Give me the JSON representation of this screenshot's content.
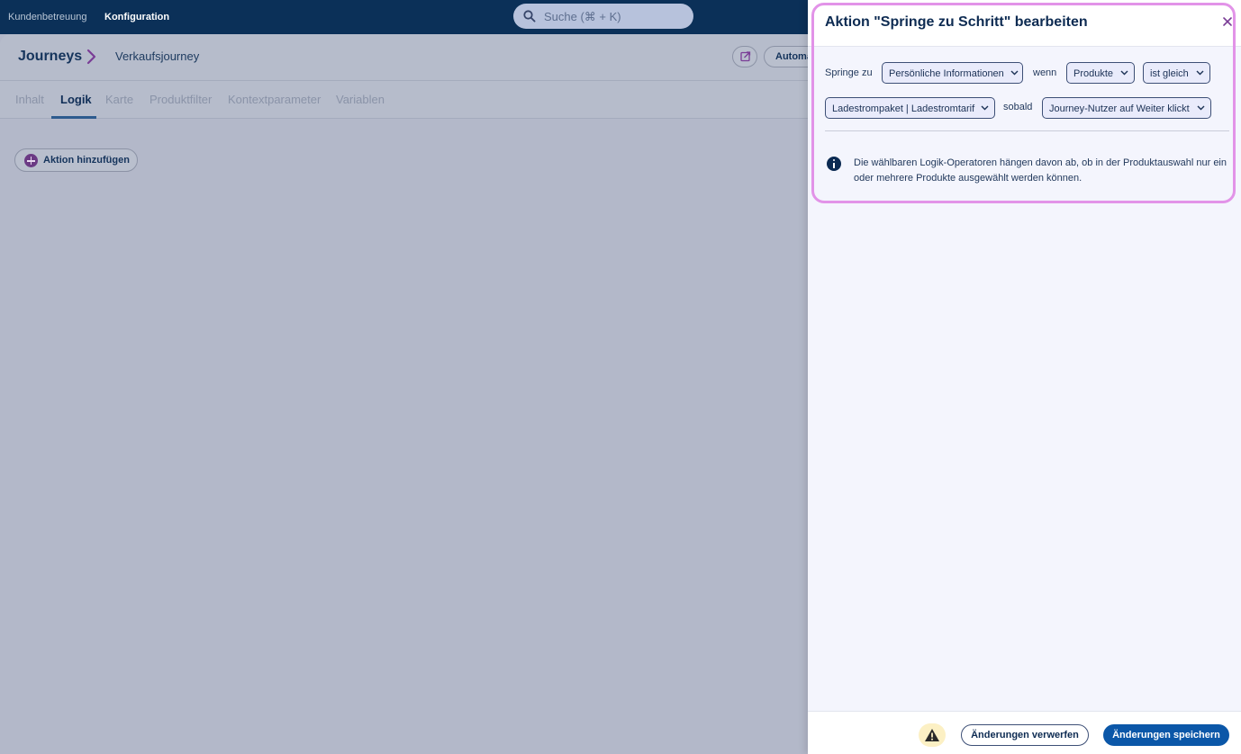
{
  "topbar": {
    "nav": [
      "Kundenbetreuung",
      "Konfiguration"
    ],
    "search_placeholder": "Suche (⌘ + K)"
  },
  "page": {
    "breadcrumb_root": "Journeys",
    "breadcrumb_page": "Verkaufsjourney",
    "auto_button_label": "Automa",
    "tabs": [
      "Inhalt",
      "Logik",
      "Karte",
      "Produktfilter",
      "Kontextparameter",
      "Variablen"
    ],
    "active_tab": "Logik",
    "add_action_label": "Aktion hinzufügen"
  },
  "panel": {
    "title": "Aktion \"Springe zu Schritt\" bearbeiten",
    "rule": {
      "label_jump_to": "Springe zu",
      "jump_to_value": "Persönliche Informationen",
      "label_if": "wenn",
      "field_value": "Produkte",
      "operator_value": "ist gleich",
      "product_value": "Ladestrompaket | Ladestromtarif",
      "label_when": "sobald",
      "trigger_value": "Journey-Nutzer auf Weiter klickt"
    },
    "info_text": "Die wählbaren Logik-Operatoren hängen davon ab, ob in der Produktauswahl nur ein oder mehrere Produkte ausgewählt werden können.",
    "footer": {
      "discard_label": "Änderungen verwerfen",
      "save_label": "Änderungen speichern"
    }
  },
  "colors": {
    "navy": "#0b3058",
    "accent_purple": "#7a3d96",
    "highlight_pink": "#e293e8",
    "primary_blue": "#0b57a8",
    "warning_bg": "#fcf0c4"
  },
  "icons": [
    "search-icon",
    "chevron-right-icon",
    "external-link-icon",
    "plus-icon",
    "close-icon",
    "chevron-down-icon",
    "info-icon",
    "warning-icon"
  ]
}
